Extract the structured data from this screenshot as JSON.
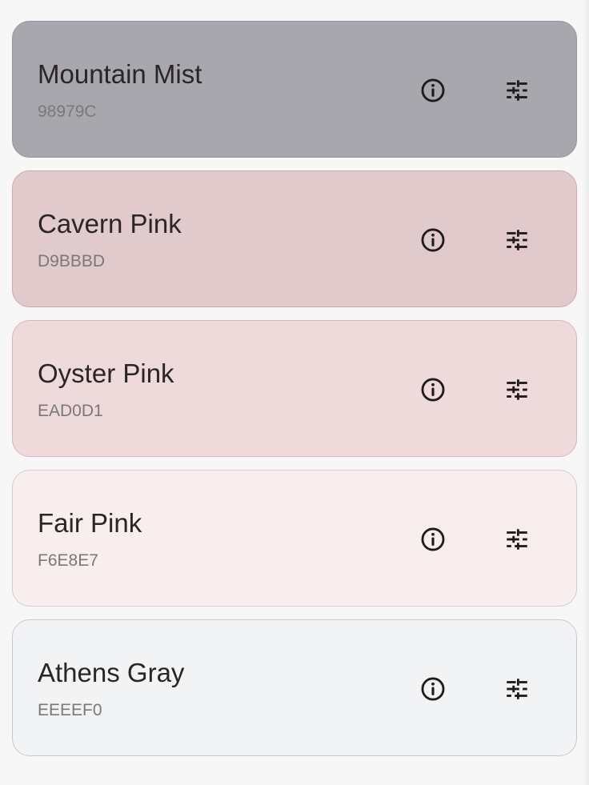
{
  "colors": [
    {
      "name": "Mountain Mist",
      "hex": "98979C",
      "bg": "#a8a7ad",
      "border": "#95949a"
    },
    {
      "name": "Cavern Pink",
      "hex": "D9BBBD",
      "bg": "#e0cacc",
      "border": "#d3a6aa"
    },
    {
      "name": "Oyster Pink",
      "hex": "EAD0D1",
      "bg": "#efdadb",
      "border": "#d7b8ba"
    },
    {
      "name": "Fair Pink",
      "hex": "F6E8E7",
      "bg": "#f8eeed",
      "border": "#ddc8c7"
    },
    {
      "name": "Athens Gray",
      "hex": "EEEEF0",
      "bg": "#f2f3f5",
      "border": "#c9c9cf"
    }
  ],
  "icons": {
    "info": "info-icon",
    "tune": "tune-icon"
  }
}
